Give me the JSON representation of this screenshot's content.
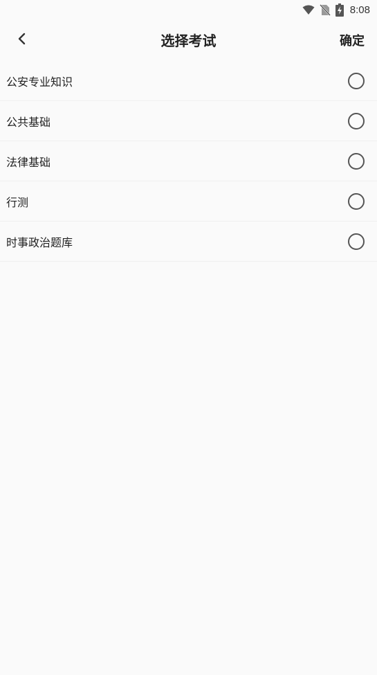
{
  "status_bar": {
    "time": "8:08",
    "icons": [
      "wifi-icon",
      "no-sim-icon",
      "battery-charging-icon"
    ]
  },
  "header": {
    "back_icon": "chevron-left-icon",
    "title": "选择考试",
    "confirm_label": "确定"
  },
  "exam_list": {
    "items": [
      {
        "label": "公安专业知识",
        "selected": false
      },
      {
        "label": "公共基础",
        "selected": false
      },
      {
        "label": "法律基础",
        "selected": false
      },
      {
        "label": "行测",
        "selected": false
      },
      {
        "label": "时事政治题库",
        "selected": false
      }
    ]
  },
  "colors": {
    "background": "#fafafa",
    "text": "#222222",
    "divider": "#f0f0f0",
    "radio_border": "#555555"
  }
}
